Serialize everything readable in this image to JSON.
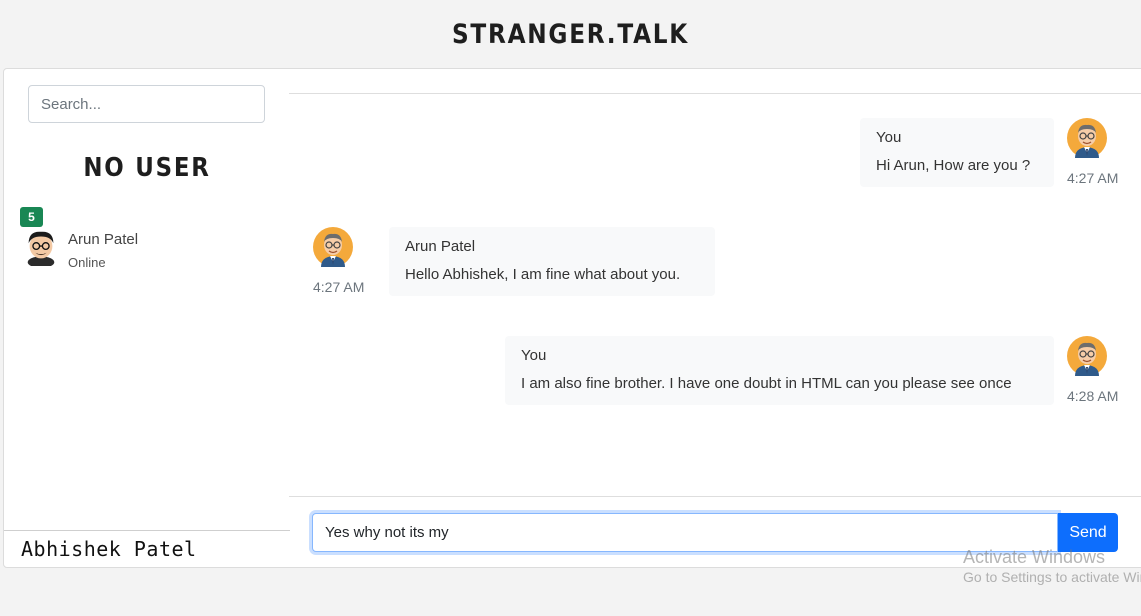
{
  "app": {
    "title": "STRANGER.TALK"
  },
  "sidebar": {
    "search_placeholder": "Search...",
    "heading": "NO USER",
    "contacts": [
      {
        "name": "Arun Patel",
        "status": "Online",
        "unread": "5",
        "avatar_icon": "cartoon-man-avatar-icon"
      }
    ],
    "current_user": "Abhishek Patel"
  },
  "chat": {
    "messages": [
      {
        "direction": "outgoing",
        "sender": "You",
        "text": "Hi Arun, How are you ?",
        "time": "4:27 AM"
      },
      {
        "direction": "incoming",
        "sender": "Arun Patel",
        "text": "Hello Abhishek, I am fine what about you.",
        "time": "4:27 AM"
      },
      {
        "direction": "outgoing",
        "sender": "You",
        "text": "I am also fine brother. I have one doubt in HTML can you please see once",
        "time": "4:28 AM"
      }
    ],
    "compose_value": "Yes why not its my",
    "send_label": "Send"
  },
  "watermark": {
    "line1": "Activate Windows",
    "line2": "Go to Settings to activate Windows."
  },
  "colors": {
    "accent": "#0d6efd",
    "badge": "#198754",
    "bubble_bg": "#f8f9fa"
  }
}
